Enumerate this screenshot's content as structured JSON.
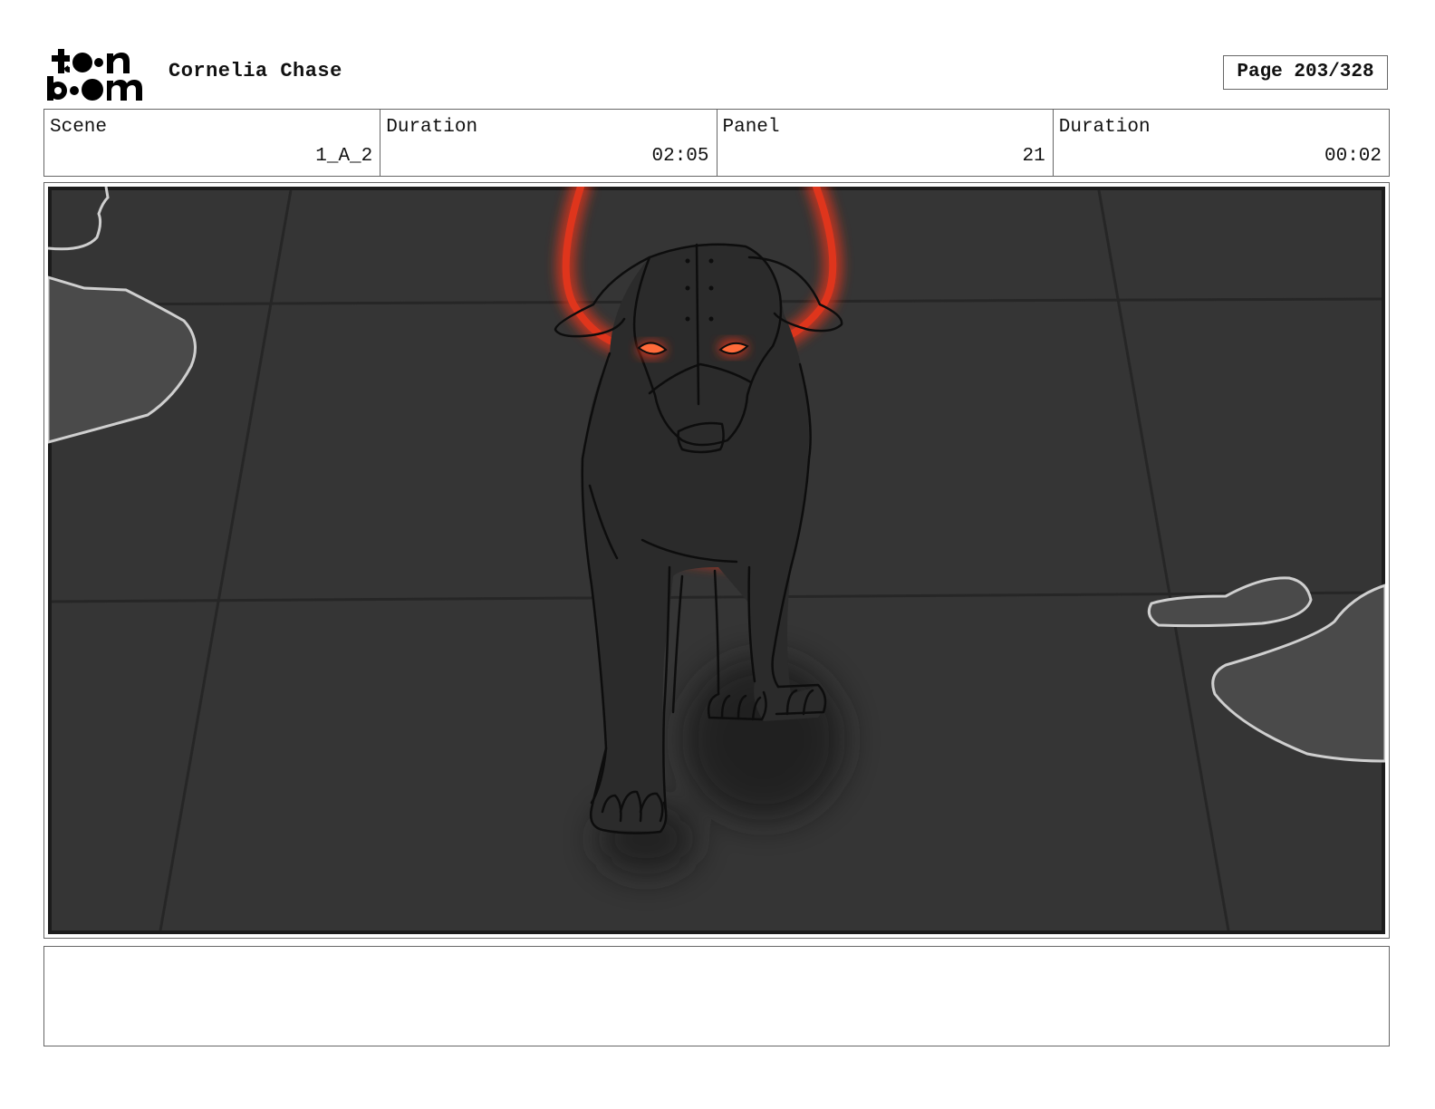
{
  "header": {
    "logo_text": "toon boom",
    "project_title": "Cornelia Chase",
    "page_label": "Page 203/328"
  },
  "info": [
    {
      "label": "Scene",
      "value": "1_A_2"
    },
    {
      "label": "Duration",
      "value": "02:05"
    },
    {
      "label": "Panel",
      "value": "21"
    },
    {
      "label": "Duration",
      "value": "00:02"
    }
  ],
  "panel": {
    "background_color": "#353535",
    "glow_color": "#e2361c",
    "puddle_color": "#4a4a4a"
  },
  "notes": ""
}
